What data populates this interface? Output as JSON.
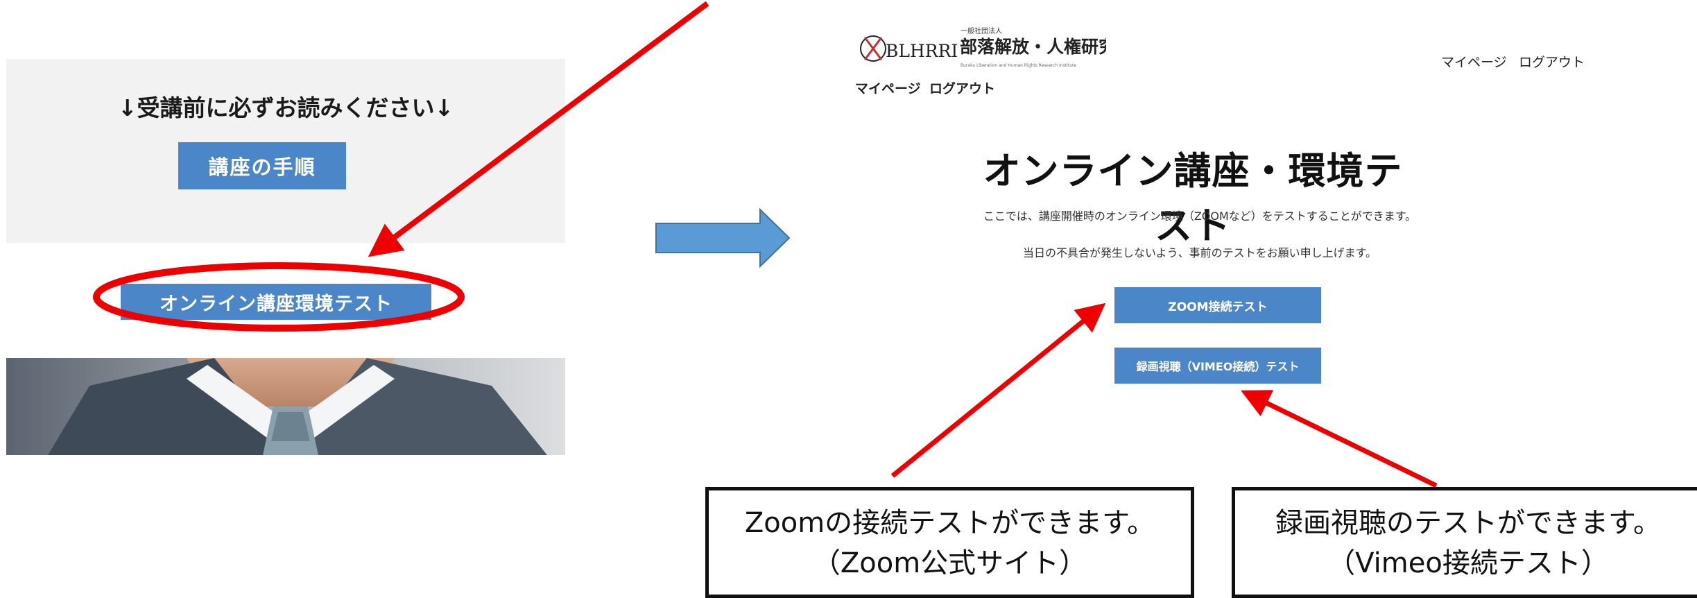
{
  "left_panel": {
    "notice": "↓受講前に必ずお読みください↓",
    "procedure_button": "講座の手順",
    "env_test_button": "オンライン講座環境テスト"
  },
  "site": {
    "logo": {
      "mark": "BLHRRI",
      "org_type": "一般社団法人",
      "org_name": "部落解放・人権研究所",
      "org_name_en": "Buraku Liberation and Human Rights Research Institute"
    },
    "nav": {
      "mypage": "マイページ",
      "logout": "ログアウト"
    },
    "title": "オンライン講座・環境テスト",
    "description_1": "ここでは、講座開催時のオンライン環境（ZOOMなど）をテストすることができます。",
    "description_2": "当日の不具合が発生しないよう、事前のテストをお願い申し上げます。",
    "zoom_button": "ZOOM接続テスト",
    "vimeo_button": "録画視聴（VIMEO接続）テスト"
  },
  "callouts": {
    "zoom_line1": "Zoomの接続テストができます。",
    "zoom_line2": "（Zoom公式サイト）",
    "vimeo_line1": "録画視聴のテストができます。",
    "vimeo_line2": "（Vimeo接続テスト）"
  },
  "colors": {
    "button_blue": "#4a86c8",
    "annotation_red": "#ee0000",
    "panel_gray": "#f2f2f2"
  },
  "icons": [
    "flow-arrow-icon",
    "red-pointer-arrow-icon",
    "highlight-ellipse"
  ]
}
